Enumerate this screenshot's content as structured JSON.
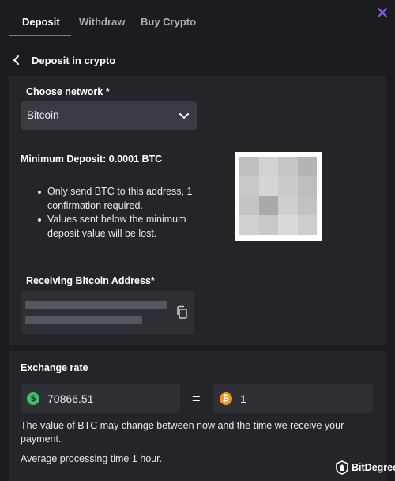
{
  "tabs": [
    {
      "label": "Deposit",
      "active": true
    },
    {
      "label": "Withdraw",
      "active": false
    },
    {
      "label": "Buy Crypto",
      "active": false
    }
  ],
  "header": {
    "title": "Deposit in crypto"
  },
  "network": {
    "label": "Choose network *",
    "selected": "Bitcoin"
  },
  "minimum_deposit": "Minimum Deposit: 0.0001 BTC",
  "instructions": [
    "Only send BTC to this address, 1 confirmation required.",
    "Values sent below the minimum deposit value will be lost."
  ],
  "address": {
    "label": "Receiving Bitcoin Address*"
  },
  "exchange": {
    "label": "Exchange rate",
    "usd_value": "70866.51",
    "equals": "=",
    "btc_value": "1",
    "usd_symbol": "$",
    "btc_symbol": "₿",
    "note": "The value of BTC may change between now and the time we receive your payment.",
    "processing": "Average processing time 1 hour."
  },
  "watermark": "BitDegree",
  "colors": {
    "accent": "#8b5cf6",
    "usd_coin": "#3fbf6b",
    "btc_coin": "#f7931a",
    "background": "#1b1c1f",
    "panel": "#242529"
  },
  "icons": [
    "close-icon",
    "back-chevron-icon",
    "chevron-down-icon",
    "copy-icon",
    "usd-coin-icon",
    "btc-coin-icon",
    "bitdegree-logo-icon"
  ]
}
